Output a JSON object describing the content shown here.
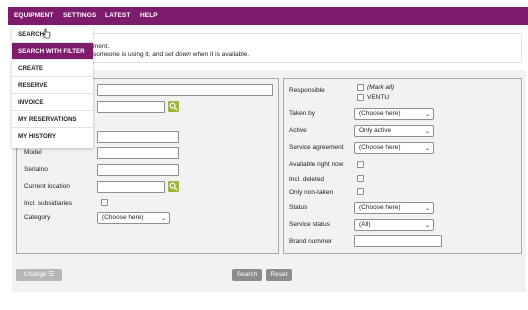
{
  "topnav": {
    "items": [
      "EQUIPMENT",
      "SETTINGS",
      "LATEST",
      "HELP"
    ]
  },
  "info": {
    "line1": "ment.",
    "line2_a": "someone is using it, and ",
    "line2_italic": "set down",
    "line2_b": " when it is available."
  },
  "dropdown": {
    "items": [
      "SEARCH",
      "SEARCH WITH FILTER",
      "CREATE",
      "RESERVE",
      "INVOICE",
      "MY RESERVATIONS",
      "MY HISTORY"
    ]
  },
  "left": {
    "model_label": "Model",
    "serial_label": "Serialno",
    "location_label": "Current location",
    "subsidiaries_label": "Incl. subsidiaries",
    "category_label": "Category",
    "category_value": "(Choose here)"
  },
  "right": {
    "responsible_label": "Responsible",
    "mark_all": "(Mark all)",
    "ventu": "VENTU",
    "taken_by_label": "Taken by",
    "taken_by_value": "(Choose here)",
    "active_label": "Active",
    "active_value": "Only active",
    "service_agreement_label": "Service agreement",
    "service_agreement_value": "(Choose here)",
    "available_now_label": "Available right now",
    "incl_deleted_label": "Incl. deleted",
    "only_non_taken_label": "Only non-taken",
    "status_label": "Status",
    "status_value": "(Choose here)",
    "service_status_label": "Service status",
    "service_status_value": "(All)",
    "brand_number_label": "Brand nummer"
  },
  "buttons": {
    "change": "Change",
    "search": "Search",
    "reset": "Reset"
  },
  "colors": {
    "brand": "#7d1b6d",
    "search_icon_bg": "#9bb93a"
  }
}
